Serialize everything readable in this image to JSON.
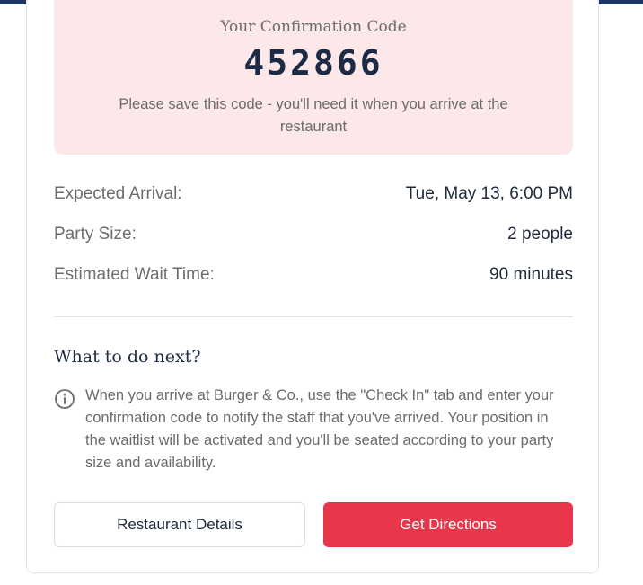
{
  "confirmation": {
    "heading": "Your Confirmation Code",
    "code": "452866",
    "note": "Please save this code - you'll need it when you arrive at the restaurant"
  },
  "details": [
    {
      "label": "Expected Arrival:",
      "value": "Tue, May 13, 6:00 PM"
    },
    {
      "label": "Party Size:",
      "value": "2 people"
    },
    {
      "label": "Estimated Wait Time:",
      "value": "90 minutes"
    }
  ],
  "next_steps": {
    "heading": "What to do next?",
    "icon": "info-circle-icon",
    "text": "When you arrive at Burger & Co., use the \"Check In\" tab and enter your confirmation code to notify the staff that you've arrived. Your position in the waitlist will be activated and you'll be seated according to your party size and availability."
  },
  "buttons": {
    "details_label": "Restaurant Details",
    "directions_label": "Get Directions"
  },
  "colors": {
    "accent": "#e8364a",
    "header_bar": "#1c3563",
    "code_background": "#fde8e9",
    "code_text": "#1b2b45"
  }
}
